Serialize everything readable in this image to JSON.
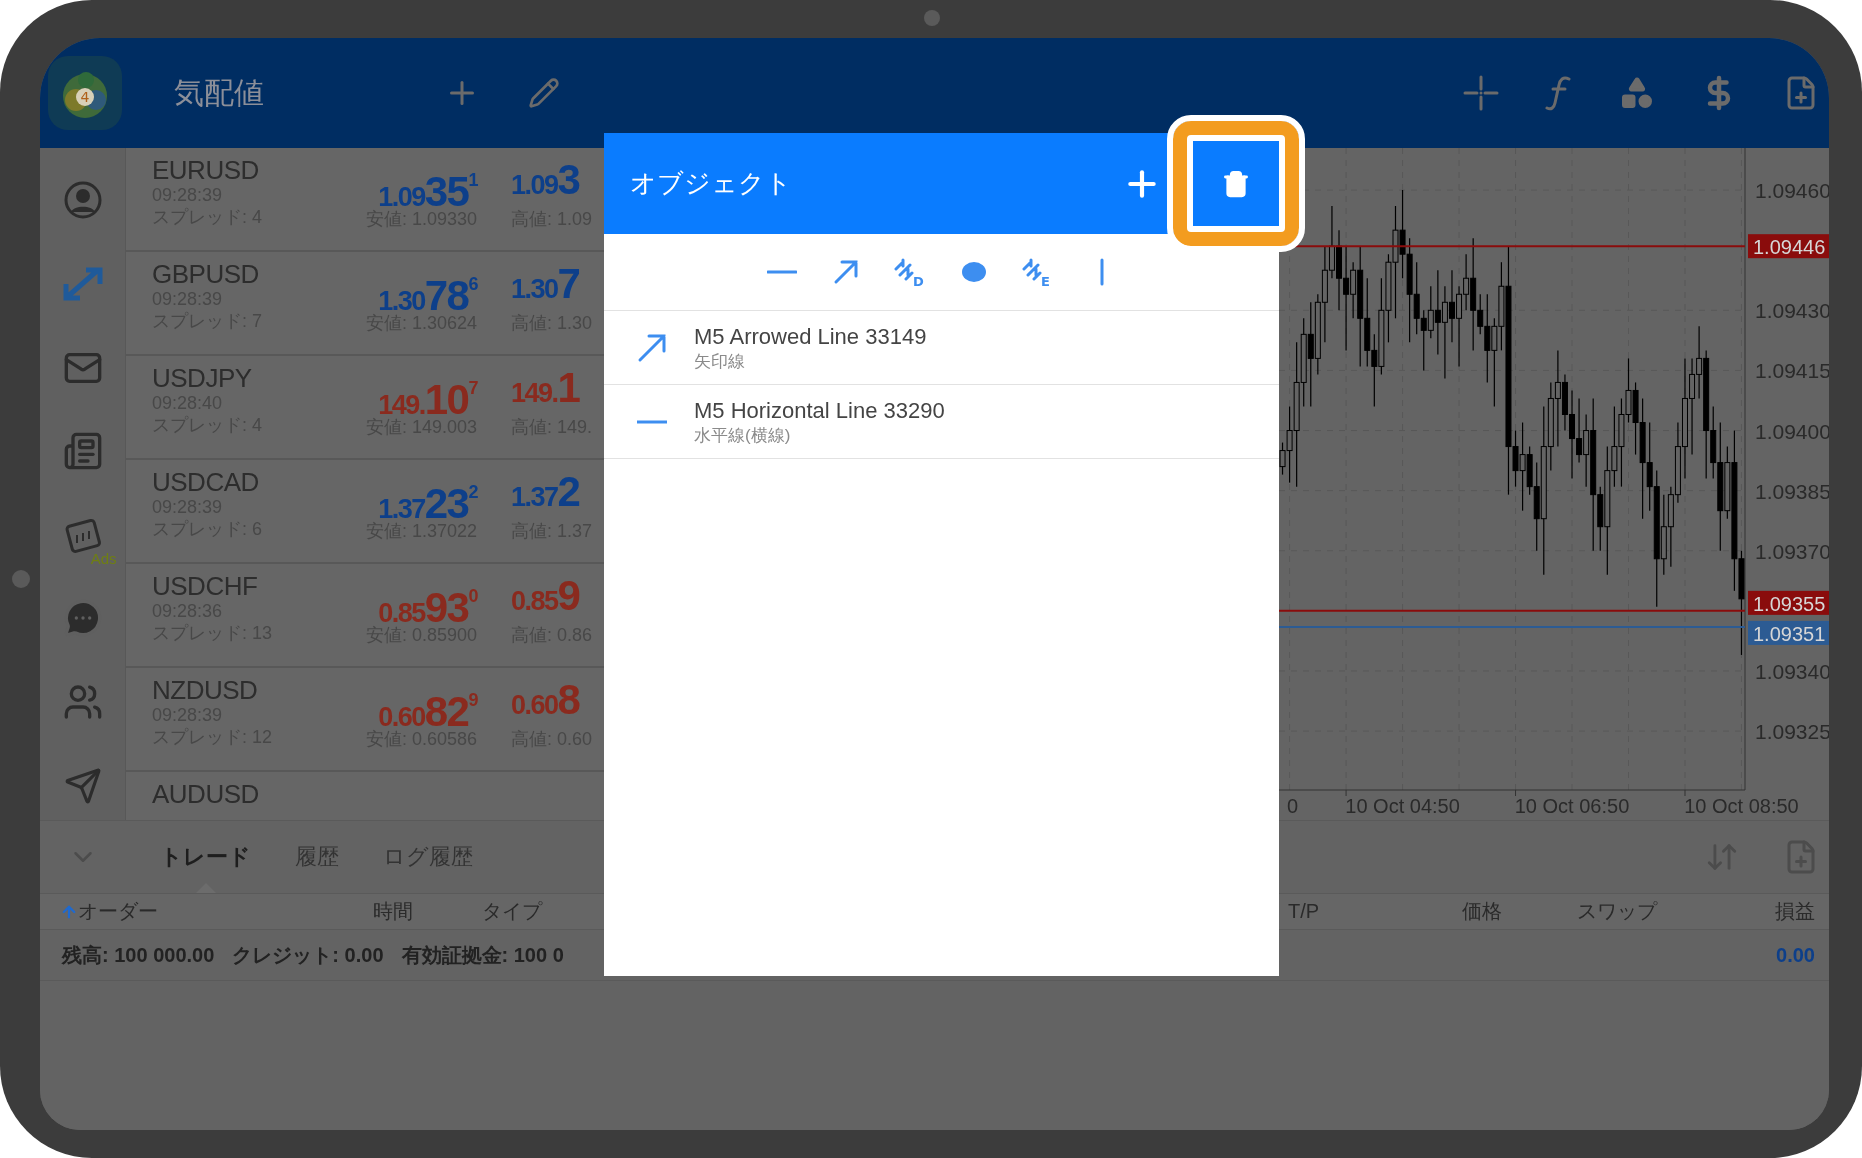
{
  "header": {
    "logo_badge": "4",
    "title": "気配値"
  },
  "sidebar": {
    "ads_label": "Ads"
  },
  "quotes": [
    {
      "symbol": "EURUSD",
      "time": "09:28:39",
      "spread": "スプレッド: 4",
      "color": "#0d3f8a",
      "bid": {
        "prefix": "1.09",
        "big": "35",
        "sup": "1"
      },
      "low": "安値: 1.09330",
      "ask": {
        "prefix": "1.09",
        "big": "3"
      },
      "high": "高値: 1.09"
    },
    {
      "symbol": "GBPUSD",
      "time": "09:28:39",
      "spread": "スプレッド: 7",
      "color": "#0d3f8a",
      "bid": {
        "prefix": "1.30",
        "big": "78",
        "sup": "6"
      },
      "low": "安値: 1.30624",
      "ask": {
        "prefix": "1.30",
        "big": "7"
      },
      "high": "高値: 1.30"
    },
    {
      "symbol": "USDJPY",
      "time": "09:28:40",
      "spread": "スプレッド: 4",
      "color": "#8a2a1e",
      "bid": {
        "prefix": "149.",
        "big": "10",
        "sup": "7"
      },
      "low": "安値: 149.003",
      "ask": {
        "prefix": "149.",
        "big": "1"
      },
      "high": "高値: 149."
    },
    {
      "symbol": "USDCAD",
      "time": "09:28:39",
      "spread": "スプレッド: 6",
      "color": "#0d3f8a",
      "bid": {
        "prefix": "1.37",
        "big": "23",
        "sup": "2"
      },
      "low": "安値: 1.37022",
      "ask": {
        "prefix": "1.37",
        "big": "2"
      },
      "high": "高値: 1.37"
    },
    {
      "symbol": "USDCHF",
      "time": "09:28:36",
      "spread": "スプレッド: 13",
      "color": "#8a2a1e",
      "bid": {
        "prefix": "0.85",
        "big": "93",
        "sup": "0"
      },
      "low": "安値: 0.85900",
      "ask": {
        "prefix": "0.85",
        "big": "9"
      },
      "high": "高値: 0.86"
    },
    {
      "symbol": "NZDUSD",
      "time": "09:28:39",
      "spread": "スプレッド: 12",
      "color": "#8a2a1e",
      "bid": {
        "prefix": "0.60",
        "big": "82",
        "sup": "9"
      },
      "low": "安値: 0.60586",
      "ask": {
        "prefix": "0.60",
        "big": "8"
      },
      "high": "高値: 0.60"
    },
    {
      "symbol": "AUDUSD"
    }
  ],
  "chart": {
    "chart_data": {
      "type": "candlestick",
      "categories": [
        null,
        null,
        null,
        null,
        null,
        null,
        null,
        null,
        null,
        null,
        null,
        null,
        null,
        null,
        null,
        null,
        null,
        "10 Oct 04:50",
        null,
        null,
        null,
        null,
        null,
        null,
        null,
        null,
        null,
        null,
        null,
        null,
        null,
        null,
        null,
        null,
        null,
        null,
        null,
        null,
        null,
        null,
        null,
        "10 Oct 06:50",
        null,
        null,
        null,
        null,
        null,
        null,
        null,
        null,
        null,
        null,
        null,
        null,
        null,
        null,
        null,
        null,
        null,
        null,
        null,
        null,
        null,
        null,
        null,
        "10 Oct 08:50"
      ],
      "ohlc": [
        [
          1.09391,
          1.09397,
          1.09389,
          1.09395
        ],
        [
          1.09395,
          1.09406,
          1.09387,
          1.094
        ],
        [
          1.094,
          1.09422,
          1.09386,
          1.09412
        ],
        [
          1.09412,
          1.09428,
          1.09406,
          1.09424
        ],
        [
          1.09424,
          1.09432,
          1.09406,
          1.09418
        ],
        [
          1.09418,
          1.09434,
          1.09414,
          1.09432
        ],
        [
          1.09432,
          1.09446,
          1.09422,
          1.0944
        ],
        [
          1.0944,
          1.09456,
          1.09438,
          1.09446
        ],
        [
          1.09446,
          1.0945,
          1.0943,
          1.09438
        ],
        [
          1.09438,
          1.09446,
          1.0942,
          1.09434
        ],
        [
          1.09434,
          1.09442,
          1.09428,
          1.0944
        ],
        [
          1.0944,
          1.09446,
          1.09416,
          1.09428
        ],
        [
          1.09428,
          1.09438,
          1.09416,
          1.0942
        ],
        [
          1.0942,
          1.09424,
          1.09406,
          1.09416
        ],
        [
          1.09416,
          1.09438,
          1.09414,
          1.0943
        ],
        [
          1.0943,
          1.09444,
          1.09422,
          1.09442
        ],
        [
          1.09442,
          1.09456,
          1.09428,
          1.0945
        ],
        [
          1.0945,
          1.0946,
          1.09438,
          1.09444
        ],
        [
          1.09444,
          1.09448,
          1.09422,
          1.09434
        ],
        [
          1.09434,
          1.09442,
          1.09424,
          1.09428
        ],
        [
          1.09428,
          1.0943,
          1.09415,
          1.09425
        ],
        [
          1.09425,
          1.09436,
          1.09423,
          1.0943
        ],
        [
          1.0943,
          1.0944,
          1.09419,
          1.09427
        ],
        [
          1.09427,
          1.09436,
          1.09413,
          1.09432
        ],
        [
          1.09432,
          1.0944,
          1.09422,
          1.09428
        ],
        [
          1.09428,
          1.09436,
          1.09416,
          1.09434
        ],
        [
          1.09434,
          1.09444,
          1.0943,
          1.09438
        ],
        [
          1.09438,
          1.09448,
          1.0942,
          1.0943
        ],
        [
          1.0943,
          1.09434,
          1.09424,
          1.09426
        ],
        [
          1.09426,
          1.09434,
          1.09412,
          1.0942
        ],
        [
          1.0942,
          1.09428,
          1.09406,
          1.09426
        ],
        [
          1.09426,
          1.09442,
          1.0942,
          1.09436
        ],
        [
          1.09436,
          1.09446,
          1.09384,
          1.09396
        ],
        [
          1.09396,
          1.094,
          1.09386,
          1.0939
        ],
        [
          1.0939,
          1.09402,
          1.0938,
          1.09394
        ],
        [
          1.09394,
          1.09396,
          1.09384,
          1.09386
        ],
        [
          1.09386,
          1.09392,
          1.0937,
          1.09378
        ],
        [
          1.09378,
          1.09406,
          1.09364,
          1.09396
        ],
        [
          1.09396,
          1.09412,
          1.0939,
          1.09408
        ],
        [
          1.09408,
          1.0942,
          1.09396,
          1.09412
        ],
        [
          1.09412,
          1.09414,
          1.094,
          1.09404
        ],
        [
          1.09404,
          1.0941,
          1.09388,
          1.09398
        ],
        [
          1.09398,
          1.09408,
          1.09392,
          1.09394
        ],
        [
          1.09394,
          1.09404,
          1.09386,
          1.094
        ],
        [
          1.094,
          1.09408,
          1.0937,
          1.09384
        ],
        [
          1.09384,
          1.09386,
          1.0937,
          1.09376
        ],
        [
          1.09376,
          1.09396,
          1.09364,
          1.0939
        ],
        [
          1.0939,
          1.09406,
          1.09386,
          1.09396
        ],
        [
          1.09396,
          1.09408,
          1.09386,
          1.09404
        ],
        [
          1.09404,
          1.09418,
          1.09402,
          1.0941
        ],
        [
          1.0941,
          1.09412,
          1.09394,
          1.09402
        ],
        [
          1.09402,
          1.09408,
          1.09378,
          1.09392
        ],
        [
          1.09392,
          1.09402,
          1.0938,
          1.09386
        ],
        [
          1.09386,
          1.0939,
          1.09356,
          1.09368
        ],
        [
          1.09368,
          1.09384,
          1.09364,
          1.09376
        ],
        [
          1.09376,
          1.09386,
          1.09366,
          1.09384
        ],
        [
          1.09384,
          1.09402,
          1.09382,
          1.09396
        ],
        [
          1.09396,
          1.09418,
          1.09388,
          1.09408
        ],
        [
          1.09408,
          1.09418,
          1.09394,
          1.09414
        ],
        [
          1.09414,
          1.09426,
          1.09408,
          1.09418
        ],
        [
          1.09418,
          1.0942,
          1.09388,
          1.094
        ],
        [
          1.094,
          1.09406,
          1.09388,
          1.09392
        ],
        [
          1.09392,
          1.09402,
          1.0937,
          1.0938
        ],
        [
          1.0938,
          1.09396,
          1.09378,
          1.09392
        ],
        [
          1.09392,
          1.094,
          1.0936,
          1.09368
        ],
        [
          1.09368,
          1.0937,
          1.09344,
          1.09358
        ]
      ],
      "ylim": [
        1.093103,
        1.094705
      ],
      "yticks": [
        {
          "value": 1.0946,
          "label": "1.09460"
        },
        {
          "value": 1.0943,
          "label": "1.09430"
        },
        {
          "value": 1.09415,
          "label": "1.09415"
        },
        {
          "value": 1.094,
          "label": "1.09400"
        },
        {
          "value": 1.09385,
          "label": "1.09385"
        },
        {
          "value": 1.0937,
          "label": "1.09370"
        },
        {
          "value": 1.0934,
          "label": "1.09340"
        },
        {
          "value": 1.09325,
          "label": "1.09325"
        }
      ],
      "grid": true,
      "ref_lines": [
        {
          "axis": "y",
          "value": 1.09446,
          "label": "1.09446",
          "color": "#8a0c0c"
        },
        {
          "axis": "y",
          "value": 1.09355,
          "label": "1.09355",
          "color": "#8a0c0c"
        },
        {
          "axis": "y",
          "value": 1.09351,
          "label": "1.09351",
          "color": "#2c5b93"
        }
      ]
    },
    "cut_time_label": "0"
  },
  "objects_dialog": {
    "title": "オブジェクト",
    "tools": [
      {
        "kind": "hline"
      },
      {
        "kind": "arrow"
      },
      {
        "kind": "fibo",
        "letter": "D"
      },
      {
        "kind": "dot"
      },
      {
        "kind": "fibo",
        "letter": "E"
      },
      {
        "kind": "vline"
      }
    ],
    "items": [
      {
        "kind": "arrow",
        "name": "M5 Arrowed Line 33149",
        "type": "矢印線"
      },
      {
        "kind": "hline",
        "name": "M5 Horizontal Line 33290",
        "type": "水平線(横線)"
      }
    ]
  },
  "bottom_panel": {
    "tabs": [
      {
        "label": "トレード",
        "selected": true
      },
      {
        "label": "履歴",
        "selected": false
      },
      {
        "label": "ログ履歴",
        "selected": false
      }
    ],
    "columns": [
      "オーダー",
      "時間",
      "タイプ",
      "T/P",
      "価格",
      "スワップ",
      "損益"
    ],
    "summary": [
      {
        "label": "残高:",
        "value": "100 000.00"
      },
      {
        "label": "クレジット:",
        "value": "0.00"
      },
      {
        "label": "有効証拠金:",
        "value": "100 0"
      }
    ],
    "profit": "0.00"
  }
}
